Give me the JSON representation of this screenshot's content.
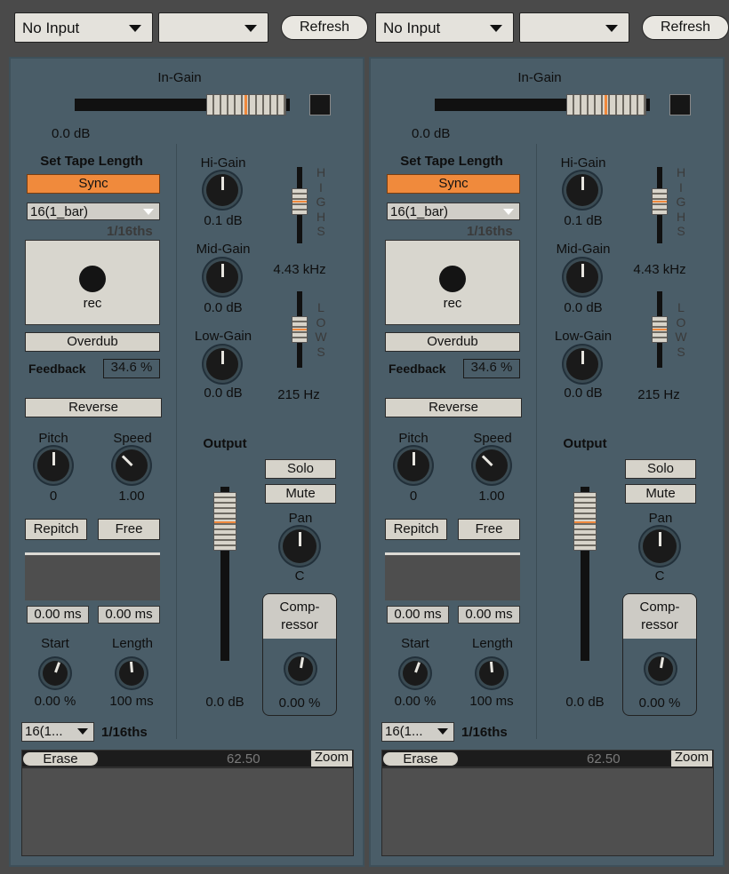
{
  "top": {
    "left_input": "No Input",
    "left_input2": "",
    "left_refresh": "Refresh",
    "right_input": "No Input",
    "right_input2": "",
    "right_refresh": "Refresh"
  },
  "channels": [
    {
      "in_gain_label": "In-Gain",
      "in_gain_value": "0.0 dB",
      "in_gain_level": 0.75,
      "tape_title": "Set Tape Length",
      "sync": "Sync",
      "bar_select": "16(1_bar)",
      "sixteenths": "1/16ths",
      "rec": "rec",
      "overdub": "Overdub",
      "feedback_label": "Feedback",
      "feedback_value": "34.6 %",
      "reverse": "Reverse",
      "pitch_label": "Pitch",
      "pitch_value": "0",
      "speed_label": "Speed",
      "speed_value": "1.00",
      "repitch": "Repitch",
      "free": "Free",
      "ms_left": "0.00 ms",
      "ms_right": "0.00 ms",
      "start_label": "Start",
      "start_value": "0.00 %",
      "length_label": "Length",
      "length_value": "100 ms",
      "bottom_select": "16(1...",
      "bottom_sixteenths": "1/16ths",
      "hi_gain_label": "Hi-Gain",
      "hi_gain_value": "0.1 dB",
      "mid_gain_label": "Mid-Gain",
      "mid_gain_value": "0.0 dB",
      "low_gain_label": "Low-Gain",
      "low_gain_value": "0.0 dB",
      "highs_letters": [
        "H",
        "I",
        "G",
        "H",
        "S"
      ],
      "highs_freq": "4.43 kHz",
      "lows_letters": [
        "L",
        "O",
        "W",
        "S"
      ],
      "lows_freq": "215 Hz",
      "output_label": "Output",
      "output_value": "0.0 dB",
      "solo": "Solo",
      "mute": "Mute",
      "pan_label": "Pan",
      "pan_value": "C",
      "comp_line1": "Comp-",
      "comp_line2": "ressor",
      "comp_value": "0.00 %",
      "erase": "Erase",
      "wave_value": "62.50",
      "zoom": "Zoom"
    },
    {
      "in_gain_label": "In-Gain",
      "in_gain_value": "0.0 dB",
      "in_gain_level": 0.75,
      "tape_title": "Set Tape Length",
      "sync": "Sync",
      "bar_select": "16(1_bar)",
      "sixteenths": "1/16ths",
      "rec": "rec",
      "overdub": "Overdub",
      "feedback_label": "Feedback",
      "feedback_value": "34.6 %",
      "reverse": "Reverse",
      "pitch_label": "Pitch",
      "pitch_value": "0",
      "speed_label": "Speed",
      "speed_value": "1.00",
      "repitch": "Repitch",
      "free": "Free",
      "ms_left": "0.00 ms",
      "ms_right": "0.00 ms",
      "start_label": "Start",
      "start_value": "0.00 %",
      "length_label": "Length",
      "length_value": "100 ms",
      "bottom_select": "16(1...",
      "bottom_sixteenths": "1/16ths",
      "hi_gain_label": "Hi-Gain",
      "hi_gain_value": "0.1 dB",
      "mid_gain_label": "Mid-Gain",
      "mid_gain_value": "0.0 dB",
      "low_gain_label": "Low-Gain",
      "low_gain_value": "0.0 dB",
      "highs_letters": [
        "H",
        "I",
        "G",
        "H",
        "S"
      ],
      "highs_freq": "4.43 kHz",
      "lows_letters": [
        "L",
        "O",
        "W",
        "S"
      ],
      "lows_freq": "215 Hz",
      "output_label": "Output",
      "output_value": "0.0 dB",
      "solo": "Solo",
      "mute": "Mute",
      "pan_label": "Pan",
      "pan_value": "C",
      "comp_line1": "Comp-",
      "comp_line2": "ressor",
      "comp_value": "0.00 %",
      "erase": "Erase",
      "wave_value": "62.50",
      "zoom": "Zoom"
    }
  ]
}
